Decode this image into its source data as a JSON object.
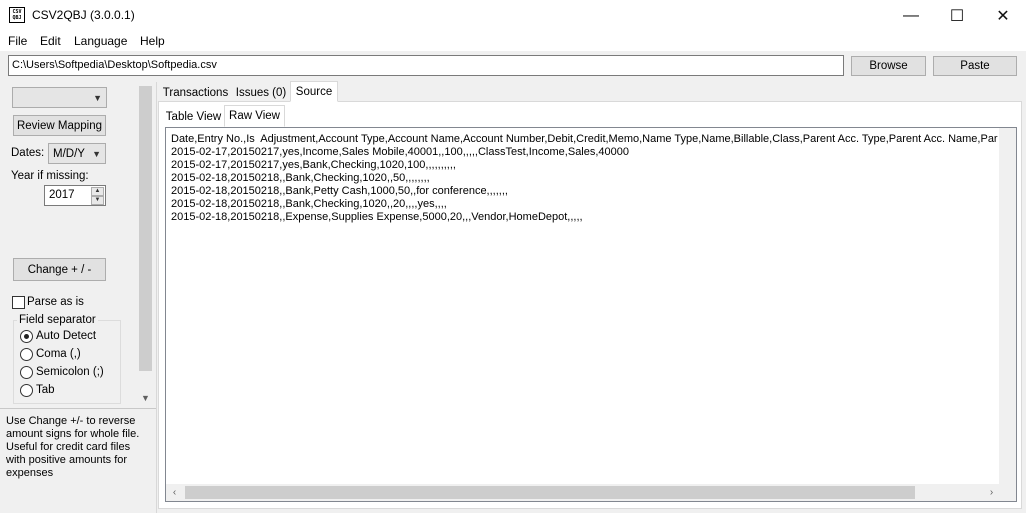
{
  "window": {
    "title": "CSV2QBJ (3.0.0.1)",
    "icon_text": "CSV\nQBJ",
    "controls": {
      "minimize": "—",
      "maximize": "☐",
      "close": "✕"
    }
  },
  "menu": [
    "File",
    "Edit",
    "Language",
    "Help"
  ],
  "toolbar": {
    "path": "C:\\Users\\Softpedia\\Desktop\\Softpedia.csv",
    "browse_label": "Browse",
    "paste_label": "Paste"
  },
  "left": {
    "mapping_combo": "",
    "review_mapping_label": "Review Mapping",
    "dates_label": "Dates:",
    "dates_value": "M/D/Y",
    "year_label": "Year if missing:",
    "year_value": "2017",
    "change_label": "Change + / -",
    "parse_as_is_label": "Parse as is",
    "parse_as_is_checked": false,
    "field_separator_label": "Field separator",
    "separators": [
      {
        "label": "Auto Detect",
        "selected": true
      },
      {
        "label": "Coma (,)",
        "selected": false
      },
      {
        "label": "Semicolon (;)",
        "selected": false
      },
      {
        "label": "Tab",
        "selected": false
      }
    ],
    "help_text": "Use Change +/- to reverse amount signs for whole file. Useful for credit card files with positive amounts for expenses"
  },
  "tabs": {
    "main": [
      "Transactions",
      "Issues (0)",
      "Source"
    ],
    "main_active": "Source",
    "sub": [
      "Table View",
      "Raw View"
    ],
    "sub_active": "Raw View"
  },
  "raw_lines": [
    "Date,Entry No.,Is  Adjustment,Account Type,Account Name,Account Number,Debit,Credit,Memo,Name Type,Name,Billable,Class,Parent Acc. Type,Parent Acc. Name,Pare",
    "2015-02-17,20150217,yes,Income,Sales Mobile,40001,,100,,,,,ClassTest,Income,Sales,40000",
    "2015-02-17,20150217,yes,Bank,Checking,1020,100,,,,,,,,,,",
    "2015-02-18,20150218,,Bank,Checking,1020,,50,,,,,,,,",
    "2015-02-18,20150218,,Bank,Petty Cash,1000,50,,for conference,,,,,,,",
    "2015-02-18,20150218,,Bank,Checking,1020,,20,,,,yes,,,,",
    "2015-02-18,20150218,,Expense,Supplies Expense,5000,20,,,Vendor,HomeDepot,,,,,"
  ]
}
